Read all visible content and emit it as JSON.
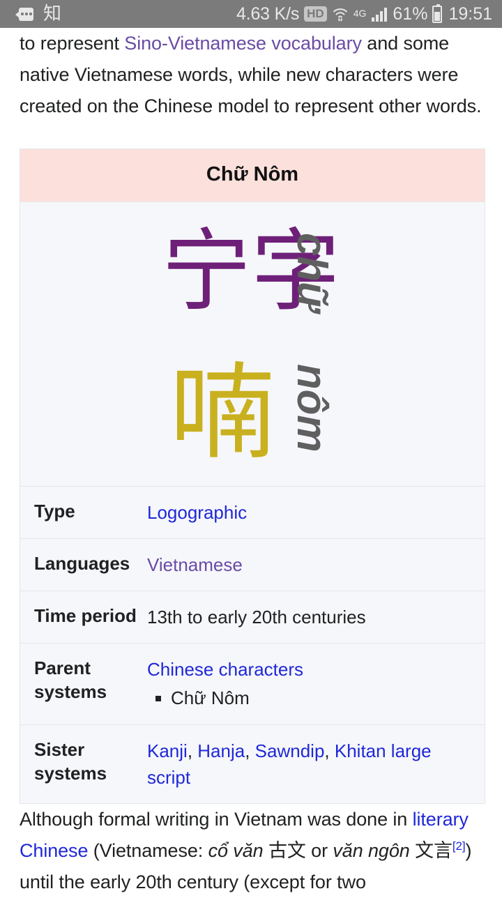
{
  "statusbar": {
    "sms_icon": "sms-message-icon",
    "app_icon_label": "知",
    "network_speed": "4.63 K/s",
    "hd_badge": "HD",
    "wifi_icon": "wifi-icon",
    "network_type": "4G",
    "signal_icon": "signal-bars-icon",
    "battery_percent": "61%",
    "battery_icon": "battery-icon",
    "clock": "19:51"
  },
  "article": {
    "top_paragraph": {
      "lead": "to represent ",
      "link1": "Sino-Vietnamese vocabulary",
      "rest": " and some native Vietnamese words, while new characters were created on the Chinese model to represent other words."
    },
    "bottom_paragraph": {
      "lead": "Although formal writing in Vietnam was done in ",
      "link1": "literary Chinese",
      "mid1": " (Vietnamese: ",
      "italic1": "cổ văn",
      "cjk1": "古文",
      "mid2": " or ",
      "italic2": "văn ngôn",
      "cjk2": "文言",
      "ref": "[2]",
      "rest": ") until the early 20th century (except for two"
    }
  },
  "infobox": {
    "title": "Chữ Nôm",
    "image": {
      "char_chu_1": "宁",
      "char_chu_2": "字",
      "char_nom": "喃",
      "roman_chu": "chữ",
      "roman_nom": "nôm",
      "color_chu": "#6e2079",
      "color_nom": "#c9b01e",
      "color_roman": "#5f5f5f"
    },
    "rows": [
      {
        "label": "Type",
        "value": "Logographic",
        "value_style": "blue-link"
      },
      {
        "label": "Languages",
        "value": "Vietnamese",
        "value_style": "purple-link"
      },
      {
        "label": "Time period",
        "value": "13th to early 20th centuries",
        "value_style": "plain"
      },
      {
        "label": "Parent systems",
        "value": "Chinese characters",
        "value_style": "blue-link",
        "sublist": [
          "Chữ Nôm"
        ]
      },
      {
        "label": "Sister systems",
        "value_style": "blue-link-list",
        "links": [
          "Kanji",
          "Hanja",
          "Sawndip",
          "Khitan large script"
        ],
        "separator": ", "
      }
    ]
  },
  "colors": {
    "statusbar_bg": "#7b7b7b",
    "infobox_header_bg": "#fce0dc",
    "infobox_body_bg": "#f6f7fa",
    "link_blue": "#1f28d8",
    "link_purple": "#6a4ba5"
  }
}
